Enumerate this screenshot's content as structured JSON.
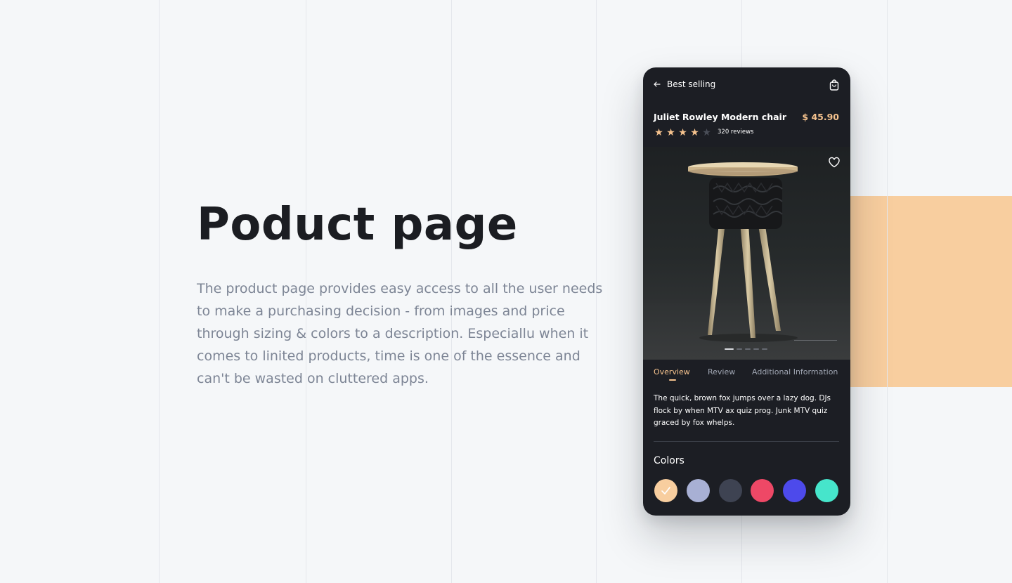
{
  "heading": "Poduct page",
  "description": "The product page provides easy access to all the user needs to make a purchasing decision - from images and price through sizing & colors to a description. Especiallu when it comes to linited products, time is one of the essence and can't be wasted on cluttered apps.",
  "colors": {
    "background": "#f5f7f9",
    "accent": "#f8ce9f",
    "phone_bg": "#1c1e24",
    "price": "#f6c38e",
    "star_filled": "#f6c38e",
    "star_empty": "#4a4e58"
  },
  "phone": {
    "topbar": {
      "back_icon": "arrow-left-icon",
      "title": "Best selling",
      "cart_icon": "shopping-bag-icon"
    },
    "product": {
      "name": "Juliet Rowley Modern chair",
      "price": "$ 45.90",
      "rating": 4,
      "rating_max": 5,
      "reviews": "320 reviews"
    },
    "image": {
      "description_icon": "stool-photo",
      "favorite_icon": "heart-icon",
      "pages": 5,
      "current_page": 1
    },
    "tabs": [
      {
        "label": "Overview",
        "active": true
      },
      {
        "label": "Review",
        "active": false
      },
      {
        "label": "Additional Information",
        "active": false
      }
    ],
    "overview_text": "The quick, brown fox jumps over a lazy dog. DJs flock by when MTV ax quiz prog. Junk MTV quiz graced by fox whelps.",
    "colors_title": "Colors",
    "swatches": [
      {
        "color": "#f8ce9f",
        "selected": true
      },
      {
        "color": "#a8b0d4",
        "selected": false
      },
      {
        "color": "#3e4352",
        "selected": false
      },
      {
        "color": "#ee4866",
        "selected": false
      },
      {
        "color": "#4d4aeb",
        "selected": false
      },
      {
        "color": "#46e5cb",
        "selected": false
      }
    ]
  }
}
